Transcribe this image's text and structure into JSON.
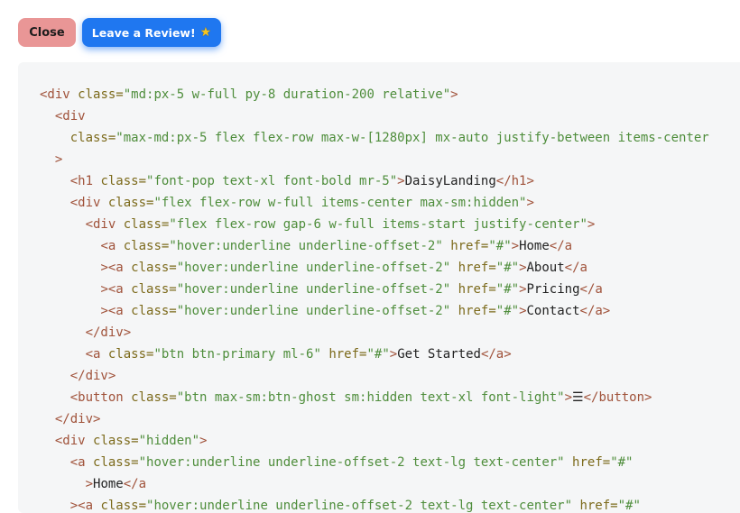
{
  "toolbar": {
    "close_label": "Close",
    "review_label": "Leave a Review!",
    "review_icon": "star-icon",
    "close_color": "#e99696",
    "review_color": "#1f77f0"
  },
  "code": {
    "lines": [
      [
        {
          "t": "tag",
          "v": "<div "
        },
        {
          "t": "attr",
          "v": "class="
        },
        {
          "t": "str",
          "v": "\"md:px-5 w-full py-8 duration-200 relative\""
        },
        {
          "t": "tag",
          "v": ">"
        }
      ],
      [
        {
          "t": "txt",
          "v": "  "
        },
        {
          "t": "tag",
          "v": "<div"
        }
      ],
      [
        {
          "t": "txt",
          "v": "    "
        },
        {
          "t": "attr",
          "v": "class="
        },
        {
          "t": "str",
          "v": "\"max-md:px-5 flex flex-row max-w-[1280px] mx-auto justify-between items-center"
        }
      ],
      [
        {
          "t": "txt",
          "v": "  "
        },
        {
          "t": "tag",
          "v": ">"
        }
      ],
      [
        {
          "t": "txt",
          "v": "    "
        },
        {
          "t": "tag",
          "v": "<h1 "
        },
        {
          "t": "attr",
          "v": "class="
        },
        {
          "t": "str",
          "v": "\"font-pop text-xl font-bold mr-5\""
        },
        {
          "t": "tag",
          "v": ">"
        },
        {
          "t": "txt",
          "v": "DaisyLanding"
        },
        {
          "t": "tag",
          "v": "</h1>"
        }
      ],
      [
        {
          "t": "txt",
          "v": "    "
        },
        {
          "t": "tag",
          "v": "<div "
        },
        {
          "t": "attr",
          "v": "class="
        },
        {
          "t": "str",
          "v": "\"flex flex-row w-full items-center max-sm:hidden\""
        },
        {
          "t": "tag",
          "v": ">"
        }
      ],
      [
        {
          "t": "txt",
          "v": "      "
        },
        {
          "t": "tag",
          "v": "<div "
        },
        {
          "t": "attr",
          "v": "class="
        },
        {
          "t": "str",
          "v": "\"flex flex-row gap-6 w-full items-start justify-center\""
        },
        {
          "t": "tag",
          "v": ">"
        }
      ],
      [
        {
          "t": "txt",
          "v": "        "
        },
        {
          "t": "tag",
          "v": "<a "
        },
        {
          "t": "attr",
          "v": "class="
        },
        {
          "t": "str",
          "v": "\"hover:underline underline-offset-2\" "
        },
        {
          "t": "attr",
          "v": "href="
        },
        {
          "t": "str",
          "v": "\"#\""
        },
        {
          "t": "tag",
          "v": ">"
        },
        {
          "t": "txt",
          "v": "Home"
        },
        {
          "t": "tag",
          "v": "</a"
        }
      ],
      [
        {
          "t": "txt",
          "v": "        "
        },
        {
          "t": "tag",
          "v": "><a "
        },
        {
          "t": "attr",
          "v": "class="
        },
        {
          "t": "str",
          "v": "\"hover:underline underline-offset-2\" "
        },
        {
          "t": "attr",
          "v": "href="
        },
        {
          "t": "str",
          "v": "\"#\""
        },
        {
          "t": "tag",
          "v": ">"
        },
        {
          "t": "txt",
          "v": "About"
        },
        {
          "t": "tag",
          "v": "</a"
        }
      ],
      [
        {
          "t": "txt",
          "v": "        "
        },
        {
          "t": "tag",
          "v": "><a "
        },
        {
          "t": "attr",
          "v": "class="
        },
        {
          "t": "str",
          "v": "\"hover:underline underline-offset-2\" "
        },
        {
          "t": "attr",
          "v": "href="
        },
        {
          "t": "str",
          "v": "\"#\""
        },
        {
          "t": "tag",
          "v": ">"
        },
        {
          "t": "txt",
          "v": "Pricing"
        },
        {
          "t": "tag",
          "v": "</a"
        }
      ],
      [
        {
          "t": "txt",
          "v": "        "
        },
        {
          "t": "tag",
          "v": "><a "
        },
        {
          "t": "attr",
          "v": "class="
        },
        {
          "t": "str",
          "v": "\"hover:underline underline-offset-2\" "
        },
        {
          "t": "attr",
          "v": "href="
        },
        {
          "t": "str",
          "v": "\"#\""
        },
        {
          "t": "tag",
          "v": ">"
        },
        {
          "t": "txt",
          "v": "Contact"
        },
        {
          "t": "tag",
          "v": "</a>"
        }
      ],
      [
        {
          "t": "txt",
          "v": "      "
        },
        {
          "t": "tag",
          "v": "</div>"
        }
      ],
      [
        {
          "t": "txt",
          "v": "      "
        },
        {
          "t": "tag",
          "v": "<a "
        },
        {
          "t": "attr",
          "v": "class="
        },
        {
          "t": "str",
          "v": "\"btn btn-primary ml-6\" "
        },
        {
          "t": "attr",
          "v": "href="
        },
        {
          "t": "str",
          "v": "\"#\""
        },
        {
          "t": "tag",
          "v": ">"
        },
        {
          "t": "txt",
          "v": "Get Started"
        },
        {
          "t": "tag",
          "v": "</a>"
        }
      ],
      [
        {
          "t": "txt",
          "v": "    "
        },
        {
          "t": "tag",
          "v": "</div>"
        }
      ],
      [
        {
          "t": "txt",
          "v": "    "
        },
        {
          "t": "tag",
          "v": "<button "
        },
        {
          "t": "attr",
          "v": "class="
        },
        {
          "t": "str",
          "v": "\"btn max-sm:btn-ghost sm:hidden text-xl font-light\""
        },
        {
          "t": "tag",
          "v": ">"
        },
        {
          "t": "txt",
          "v": "☰"
        },
        {
          "t": "tag",
          "v": "</button>"
        }
      ],
      [
        {
          "t": "txt",
          "v": "  "
        },
        {
          "t": "tag",
          "v": "</div>"
        }
      ],
      [
        {
          "t": "txt",
          "v": "  "
        },
        {
          "t": "tag",
          "v": "<div "
        },
        {
          "t": "attr",
          "v": "class="
        },
        {
          "t": "str",
          "v": "\"hidden\""
        },
        {
          "t": "tag",
          "v": ">"
        }
      ],
      [
        {
          "t": "txt",
          "v": "    "
        },
        {
          "t": "tag",
          "v": "<a "
        },
        {
          "t": "attr",
          "v": "class="
        },
        {
          "t": "str",
          "v": "\"hover:underline underline-offset-2 text-lg text-center\" "
        },
        {
          "t": "attr",
          "v": "href="
        },
        {
          "t": "str",
          "v": "\"#\""
        }
      ],
      [
        {
          "t": "txt",
          "v": "      "
        },
        {
          "t": "tag",
          "v": ">"
        },
        {
          "t": "txt",
          "v": "Home"
        },
        {
          "t": "tag",
          "v": "</a"
        }
      ],
      [
        {
          "t": "txt",
          "v": "    "
        },
        {
          "t": "tag",
          "v": "><a "
        },
        {
          "t": "attr",
          "v": "class="
        },
        {
          "t": "str",
          "v": "\"hover:underline underline-offset-2 text-lg text-center\" "
        },
        {
          "t": "attr",
          "v": "href="
        },
        {
          "t": "str",
          "v": "\"#\""
        }
      ]
    ]
  }
}
